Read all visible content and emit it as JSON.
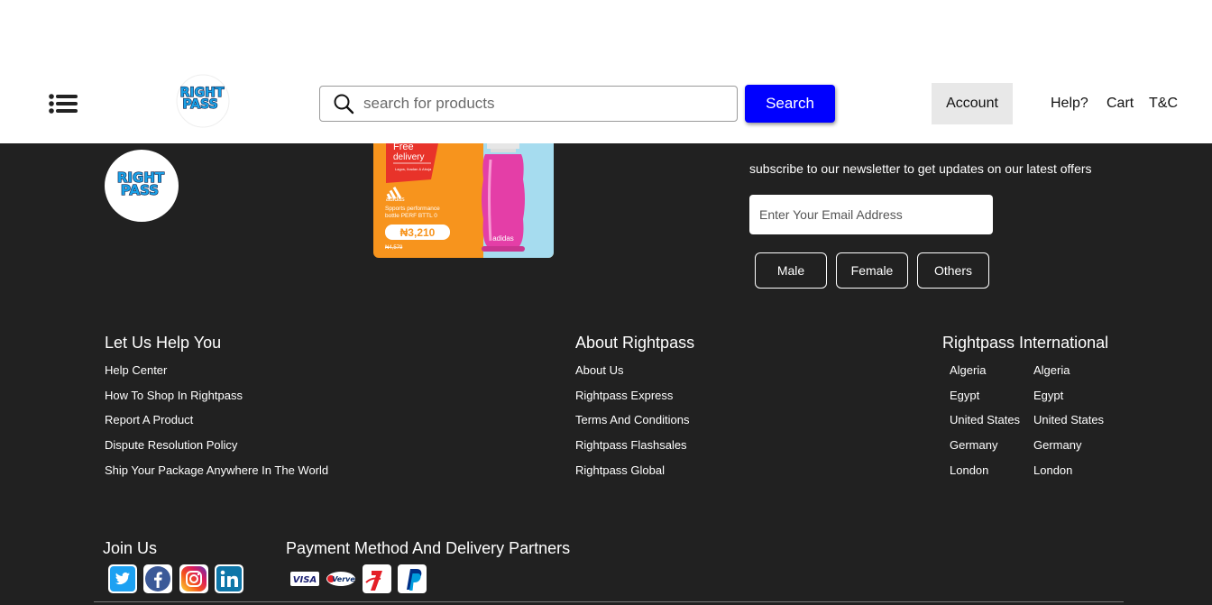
{
  "header": {
    "search_placeholder": "search for products",
    "search_button": "Search",
    "account": "Account",
    "links": {
      "help": "Help?",
      "cart": "Cart",
      "tc": "T&C"
    },
    "logo_text_top": "RIGHT",
    "logo_text_bottom": "PASS"
  },
  "promo": {
    "tag_line1": "Free",
    "tag_line2": "delivery",
    "tag_sub": "Lagos, Ibadan & Abuja",
    "brand": "adidas",
    "product_line1": "Spports performance",
    "product_line2": "bottle PERF BTTL 0",
    "price": "₦3,210",
    "old_price": "₦4,579",
    "bottle_brand": "adidas"
  },
  "newsletter": {
    "text": "subscribe to our newsletter to get updates on our latest offers",
    "email_placeholder": "Enter Your Email Address",
    "genders": [
      "Male",
      "Female",
      "Others"
    ]
  },
  "columns": {
    "help": {
      "title": "Let Us Help You",
      "items": [
        "Help Center",
        "How To Shop In Rightpass",
        "Report A Product",
        "Dispute Resolution Policy",
        "Ship Your Package Anywhere In The World"
      ]
    },
    "about": {
      "title": "About Rightpass",
      "items": [
        "About Us",
        "Rightpass Express",
        "Terms And Conditions",
        "Rightpass Flashsales",
        "Rightpass Global"
      ]
    },
    "international": {
      "title": "Rightpass International",
      "items_left": [
        "Algeria",
        "Egypt",
        "United States",
        "Germany",
        "London"
      ],
      "items_right": [
        "Algeria",
        "Egypt",
        "United States",
        "Germany",
        "London"
      ]
    }
  },
  "join": {
    "title": "Join Us",
    "icons": [
      "twitter-icon",
      "facebook-icon",
      "instagram-icon",
      "linkedin-icon"
    ]
  },
  "payment": {
    "title": "Payment Method And Delivery Partners",
    "visa": "VISA",
    "verve": "Verve",
    "icons": [
      "visa-logo",
      "verve-logo",
      "jumia-logo",
      "paypal-logo"
    ]
  },
  "colors": {
    "footer_bg": "#212121",
    "search_button": "#0000ff",
    "account_bg": "#e8e8e8",
    "logo_blue": "#1aa0e6"
  }
}
